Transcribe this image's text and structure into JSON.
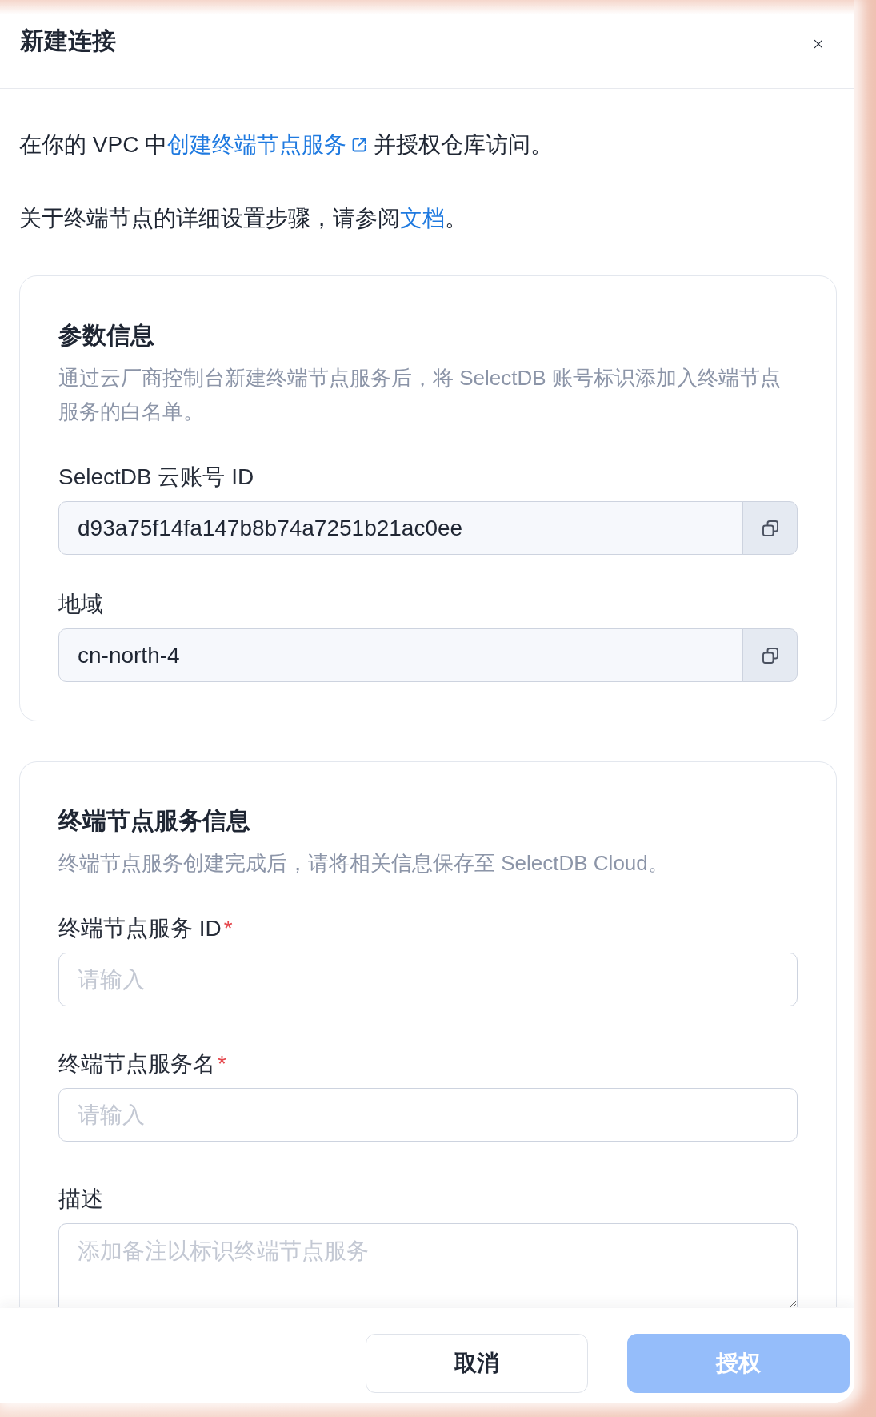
{
  "dialog": {
    "title": "新建连接"
  },
  "intro": [
    {
      "segments": [
        {
          "kind": "text",
          "text": "在你的 VPC 中"
        },
        {
          "kind": "link",
          "text": "创建终端节点服务",
          "external": true
        },
        {
          "kind": "text",
          "text": " 并授权仓库访问。"
        }
      ]
    },
    {
      "segments": [
        {
          "kind": "text",
          "text": "关于终端节点的详细设置步骤，请参阅"
        },
        {
          "kind": "link",
          "text": "文档",
          "external": false
        },
        {
          "kind": "text",
          "text": "。"
        }
      ]
    }
  ],
  "sections": [
    {
      "title": "参数信息",
      "description": "通过云厂商控制台新建终端节点服务后，将 SelectDB 账号标识添加入终端节点服务的白名单。",
      "fields": [
        {
          "kind": "copy",
          "label": "SelectDB 云账号 ID",
          "value": "d93a75f14fa147b8b74a7251b21ac0ee"
        },
        {
          "kind": "copy",
          "label": "地域",
          "value": "cn-north-4"
        }
      ]
    },
    {
      "title": "终端节点服务信息",
      "description": "终端节点服务创建完成后，请将相关信息保存至 SelectDB Cloud。",
      "fields": [
        {
          "kind": "input",
          "label": "终端节点服务 ID",
          "required_mark": "*",
          "placeholder": "请输入"
        },
        {
          "kind": "input",
          "label": "终端节点服务名",
          "required_mark": "*",
          "placeholder": "请输入"
        },
        {
          "kind": "textarea",
          "label": "描述",
          "placeholder": "添加备注以标识终端节点服务"
        }
      ]
    }
  ],
  "footer": {
    "buttons": [
      {
        "kind": "secondary",
        "label": "取消",
        "disabled": false
      },
      {
        "kind": "primary",
        "label": "授权",
        "disabled": true
      }
    ]
  }
}
